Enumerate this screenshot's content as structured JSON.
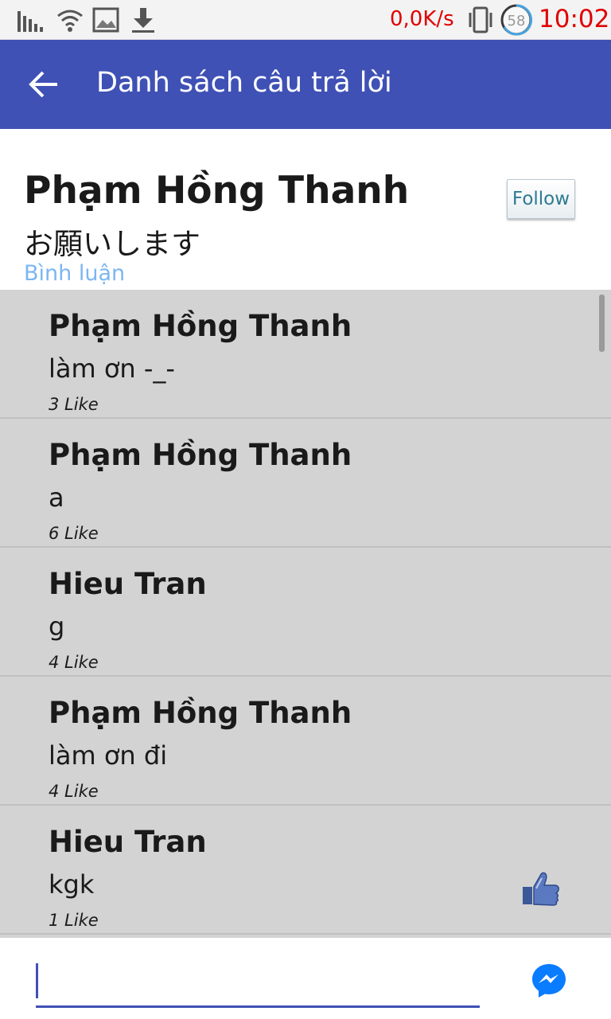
{
  "status_bar": {
    "net_speed": "0,0K/s",
    "battery_badge": "58",
    "time": "10:02",
    "icons": [
      "signal-bars-icon",
      "wifi-icon",
      "image-icon",
      "download-icon",
      "vibrate-phone-icon",
      "battery-circle-icon"
    ]
  },
  "app_bar": {
    "title": "Danh sách câu trả lời",
    "back_icon": "arrow-left-icon"
  },
  "question": {
    "author": "Phạm Hồng Thanh",
    "text": "お願いします",
    "comment_link": "Bình luận",
    "follow_label": "Follow"
  },
  "answers": [
    {
      "author": "Phạm Hồng Thanh",
      "text": "làm ơn -_-",
      "likes": "3 Like"
    },
    {
      "author": "Phạm Hồng Thanh",
      "text": "a",
      "likes": "6 Like"
    },
    {
      "author": "Hieu Tran",
      "text": "g",
      "likes": "4 Like"
    },
    {
      "author": "Phạm Hồng Thanh",
      "text": "làm ơn đi",
      "likes": "4 Like"
    },
    {
      "author": "Hieu Tran",
      "text": "kgk",
      "likes": "1 Like",
      "like_icon": "thumbs-up-icon"
    }
  ],
  "composer": {
    "value": "",
    "send_icon": "messenger-icon"
  },
  "colors": {
    "app_bar": "#3f51b5",
    "status_text": "#e00000",
    "link": "#7cb6f2",
    "list_bg": "#d3d3d3",
    "messenger": "#0a7cff"
  }
}
